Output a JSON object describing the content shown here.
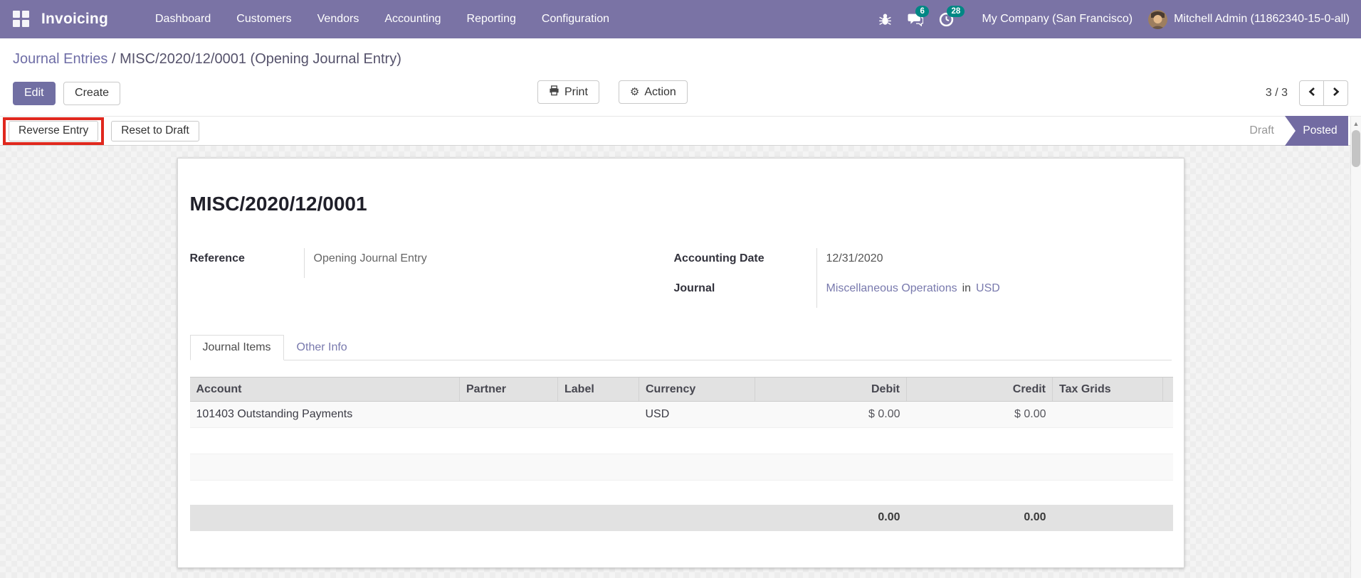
{
  "colors": {
    "navbar-bg": "#7a73a5",
    "accent": "#716fa3",
    "badge-bg": "#008784",
    "link": "#7879ad",
    "highlight-red": "#e0281e",
    "statusbar-active": "#726ba2",
    "table-header-bg": "#e2e2e2"
  },
  "navbar": {
    "app_name": "Invoicing",
    "menus": [
      "Dashboard",
      "Customers",
      "Vendors",
      "Accounting",
      "Reporting",
      "Configuration"
    ],
    "messages_badge": "6",
    "activities_badge": "28",
    "company": "My Company (San Francisco)",
    "user": "Mitchell Admin (11862340-15-0-all)"
  },
  "breadcrumb": {
    "parent": "Journal Entries",
    "separator": " / ",
    "current": "MISC/2020/12/0001 (Opening Journal Entry)"
  },
  "control_panel": {
    "edit": "Edit",
    "create": "Create",
    "print": "Print",
    "action": "Action",
    "pager_value": "3 / 3"
  },
  "statusbar": {
    "buttons": [
      "Reverse Entry",
      "Reset to Draft"
    ],
    "states": [
      "Draft",
      "Posted"
    ],
    "active_state": "Posted"
  },
  "sheet": {
    "title": "MISC/2020/12/0001",
    "fields": {
      "reference": {
        "label": "Reference",
        "value": "Opening Journal Entry"
      },
      "accounting_date": {
        "label": "Accounting Date",
        "value": "12/31/2020"
      },
      "journal": {
        "label": "Journal",
        "value": "Miscellaneous Operations",
        "connector": "in",
        "currency": "USD"
      }
    },
    "tabs": [
      {
        "label": "Journal Items",
        "active": true
      },
      {
        "label": "Other Info",
        "active": false
      }
    ],
    "table": {
      "columns": [
        "Account",
        "Partner",
        "Label",
        "Currency",
        "Debit",
        "Credit",
        "Tax Grids"
      ],
      "rows": [
        {
          "account": "101403 Outstanding Payments",
          "partner": "",
          "label": "",
          "currency": "USD",
          "debit": "$ 0.00",
          "credit": "$ 0.00",
          "tax_grids": ""
        }
      ],
      "totals": {
        "debit": "0.00",
        "credit": "0.00"
      }
    }
  }
}
